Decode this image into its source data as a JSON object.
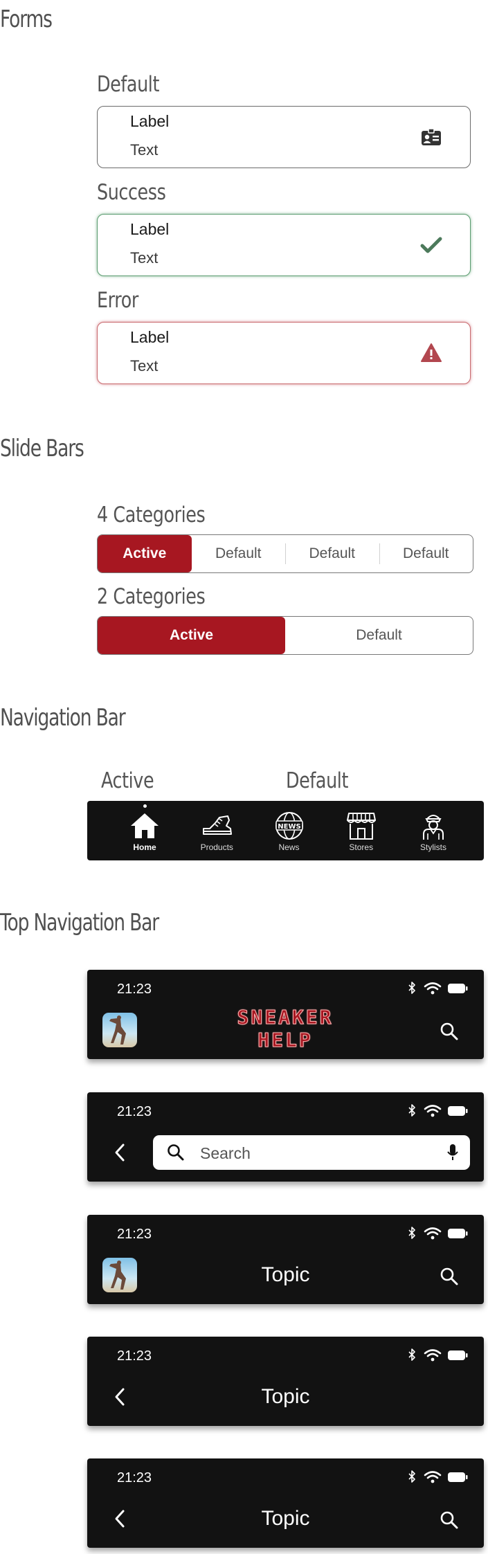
{
  "sections": {
    "forms": "Forms",
    "slide_bars": "Slide Bars",
    "navigation_bar": "Navigation Bar",
    "top_navigation_bar": "Top Navigation Bar"
  },
  "forms": {
    "default": {
      "title": "Default",
      "label": "Label",
      "text": "Text",
      "icon": "id-card-icon"
    },
    "success": {
      "title": "Success",
      "label": "Label",
      "text": "Text",
      "icon": "check-icon",
      "color": "#5b9c70"
    },
    "error": {
      "title": "Error",
      "label": "Label",
      "text": "Text",
      "icon": "warning-icon",
      "color": "#b2474f"
    }
  },
  "slide_bars": {
    "four": {
      "title": "4 Categories",
      "items": [
        "Active",
        "Default",
        "Default",
        "Default"
      ]
    },
    "two": {
      "title": "2 Categories",
      "items": [
        "Active",
        "Default"
      ]
    },
    "active_color": "#a71721"
  },
  "navigation_bar": {
    "active_label": "Active",
    "default_label": "Default",
    "items": [
      {
        "label": "Home",
        "icon": "home-icon"
      },
      {
        "label": "Products",
        "icon": "sneaker-icon"
      },
      {
        "label": "News",
        "icon": "news-globe-icon"
      },
      {
        "label": "Stores",
        "icon": "store-icon"
      },
      {
        "label": "Stylists",
        "icon": "stylist-icon"
      }
    ]
  },
  "top_bars": {
    "time": "21:23",
    "logo": [
      "SNEAKER",
      "HELP"
    ],
    "search_placeholder": "Search",
    "topic": "Topic"
  }
}
